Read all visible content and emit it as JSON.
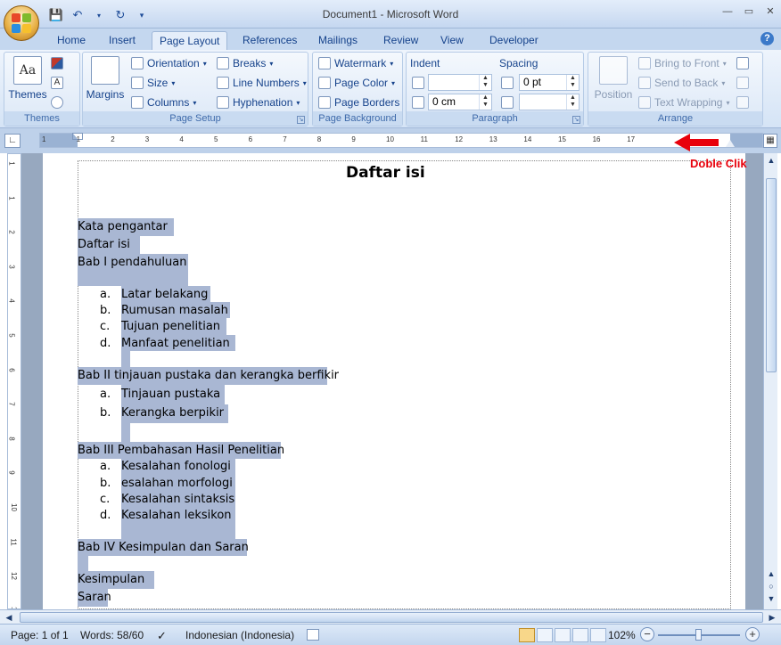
{
  "window": {
    "title": "Document1 - Microsoft Word"
  },
  "tabs": [
    "Home",
    "Insert",
    "Page Layout",
    "References",
    "Mailings",
    "Review",
    "View",
    "Developer"
  ],
  "active_tab": "Page Layout",
  "ribbon": {
    "themes": {
      "label": "Themes",
      "group": "Themes"
    },
    "page_setup": {
      "margins": "Margins",
      "orientation": "Orientation",
      "size": "Size",
      "columns": "Columns",
      "breaks": "Breaks",
      "line_numbers": "Line Numbers",
      "hyphenation": "Hyphenation",
      "group": "Page Setup"
    },
    "page_background": {
      "watermark": "Watermark",
      "page_color": "Page Color",
      "page_borders": "Page Borders",
      "group": "Page Background"
    },
    "paragraph": {
      "indent_label": "Indent",
      "spacing_label": "Spacing",
      "indent_left": "",
      "indent_right": "0 cm",
      "spacing_before": "0 pt",
      "spacing_after": "",
      "group": "Paragraph"
    },
    "arrange": {
      "position": "Position",
      "bring_to_front": "Bring to Front",
      "send_to_back": "Send to Back",
      "text_wrapping": "Text Wrapping",
      "group": "Arrange"
    }
  },
  "ruler": {
    "numbers": [
      "1",
      "1",
      "2",
      "3",
      "4",
      "5",
      "6",
      "7",
      "8",
      "9",
      "10",
      "11",
      "12",
      "13",
      "14",
      "15",
      "16",
      "17"
    ],
    "vnumbers": [
      "1",
      "1",
      "2",
      "3",
      "4",
      "5",
      "6",
      "7",
      "8",
      "9",
      "10",
      "11",
      "12",
      "13"
    ]
  },
  "annotation": "Doble Clik",
  "document": {
    "title": "Daftar isi",
    "lines": [
      {
        "text": "Kata pengantar"
      },
      {
        "text": "Daftar isi"
      },
      {
        "text": "Bab I pendahuluan"
      },
      {
        "letter": "a.",
        "text": "Latar belakang"
      },
      {
        "letter": "b.",
        "text": "Rumusan masalah"
      },
      {
        "letter": "c.",
        "text": "Tujuan penelitian"
      },
      {
        "letter": "d.",
        "text": "Manfaat penelitian"
      },
      {
        "text": "Bab II tinjauan pustaka dan kerangka berfikir"
      },
      {
        "letter": "a.",
        "text": "Tinjauan pustaka"
      },
      {
        "letter": "b.",
        "text": "Kerangka berpikir"
      },
      {
        "text": "Bab III Pembahasan Hasil Penelitian"
      },
      {
        "letter": "a.",
        "text": "Kesalahan fonologi"
      },
      {
        "letter": "b.",
        "text": "esalahan morfologi"
      },
      {
        "letter": "c.",
        "text": "Kesalahan sintaksis"
      },
      {
        "letter": "d.",
        "text": "Kesalahan leksikon"
      },
      {
        "text": "Bab IV Kesimpulan dan Saran"
      },
      {
        "text": "Kesimpulan"
      },
      {
        "text": "Saran"
      }
    ]
  },
  "status": {
    "page": "Page: 1 of 1",
    "words": "Words: 58/60",
    "language": "Indonesian (Indonesia)",
    "zoom": "102%"
  }
}
